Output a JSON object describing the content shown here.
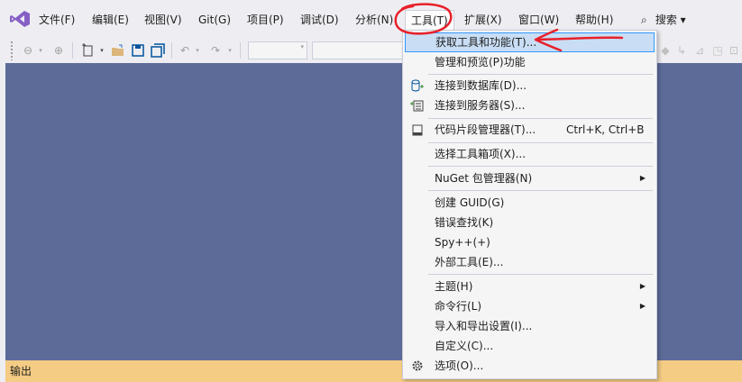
{
  "menubar": {
    "items": [
      {
        "label": "文件(F)"
      },
      {
        "label": "编辑(E)"
      },
      {
        "label": "视图(V)"
      },
      {
        "label": "Git(G)"
      },
      {
        "label": "项目(P)"
      },
      {
        "label": "调试(D)"
      },
      {
        "label": "分析(N)"
      },
      {
        "label": "工具(T)"
      },
      {
        "label": "扩展(X)"
      },
      {
        "label": "窗口(W)"
      },
      {
        "label": "帮助(H)"
      }
    ],
    "search_label": "搜索 ▾"
  },
  "tools_menu": {
    "items": [
      {
        "label": "获取工具和功能(T)..."
      },
      {
        "label": "管理和预览(P)功能"
      },
      {
        "label": "连接到数据库(D)..."
      },
      {
        "label": "连接到服务器(S)..."
      },
      {
        "label": "代码片段管理器(T)...",
        "shortcut": "Ctrl+K, Ctrl+B"
      },
      {
        "label": "选择工具箱项(X)..."
      },
      {
        "label": "NuGet 包管理器(N)"
      },
      {
        "label": "创建 GUID(G)"
      },
      {
        "label": "错误查找(K)"
      },
      {
        "label": "Spy++(+)"
      },
      {
        "label": "外部工具(E)..."
      },
      {
        "label": "主题(H)"
      },
      {
        "label": "命令行(L)"
      },
      {
        "label": "导入和导出设置(I)..."
      },
      {
        "label": "自定义(C)..."
      },
      {
        "label": "选项(O)..."
      }
    ]
  },
  "output_panel": {
    "label": "输出"
  },
  "colors": {
    "editor_bg": "#5d6b99",
    "output_bar": "#f5cc84",
    "highlight": "#c9def5",
    "annotation": "#e8202a",
    "vs_purple": "#865fc5"
  }
}
